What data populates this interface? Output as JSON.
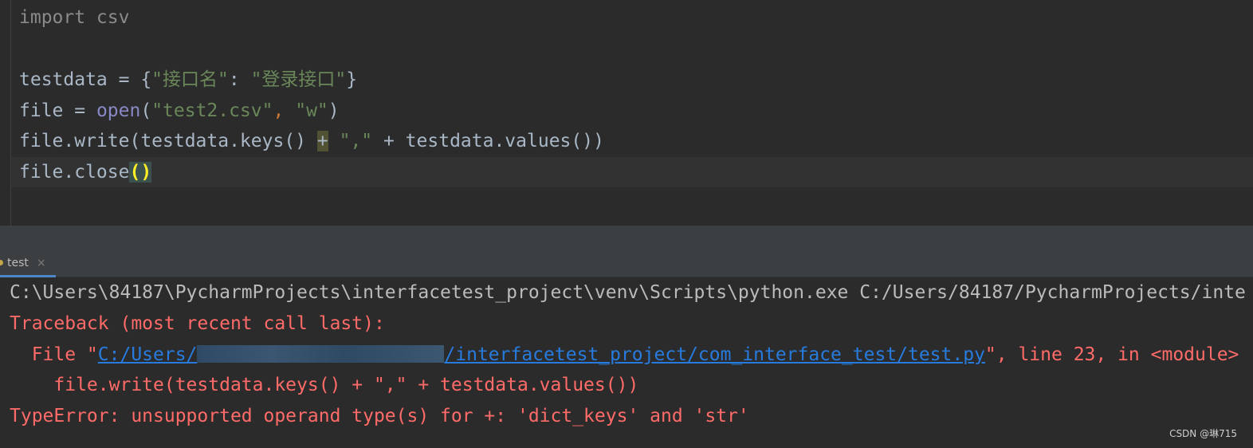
{
  "editor": {
    "lines": [
      {
        "text": "import csv"
      },
      {
        "text": ""
      },
      {
        "parts": [
          "testdata = {",
          "\"接口名\"",
          ": ",
          "\"登录接口\"",
          "}"
        ]
      },
      {
        "parts": [
          "file = ",
          "open",
          "(",
          "\"test2.csv\"",
          ", ",
          "\"w\"",
          ")"
        ]
      },
      {
        "parts": [
          "file.write(testdata.keys() ",
          "+",
          " ",
          "\",\"",
          " + testdata.values())"
        ]
      },
      {
        "parts": [
          "file.close",
          "()"
        ]
      }
    ]
  },
  "run_tab": {
    "label": "test",
    "close_glyph": "×"
  },
  "console": {
    "cmd_line": "C:\\Users\\84187\\PycharmProjects\\interfacetest_project\\venv\\Scripts\\python.exe C:/Users/84187/PycharmProjects/inte",
    "traceback": "Traceback (most recent call last):",
    "file_prefix": "  File \"",
    "file_link_start": "C:/Users/",
    "file_link_end": "/interfacetest_project/com_interface_test/test.py",
    "file_suffix": "\", line 23, in <module>",
    "code_line": "    file.write(testdata.keys() + \",\" + testdata.values())",
    "error": "TypeError: unsupported operand type(s) for +: 'dict_keys' and 'str'"
  },
  "watermark": "CSDN @琳715",
  "colors": {
    "string": "#6a8759",
    "error": "#ff6b68",
    "link": "#287bde"
  }
}
